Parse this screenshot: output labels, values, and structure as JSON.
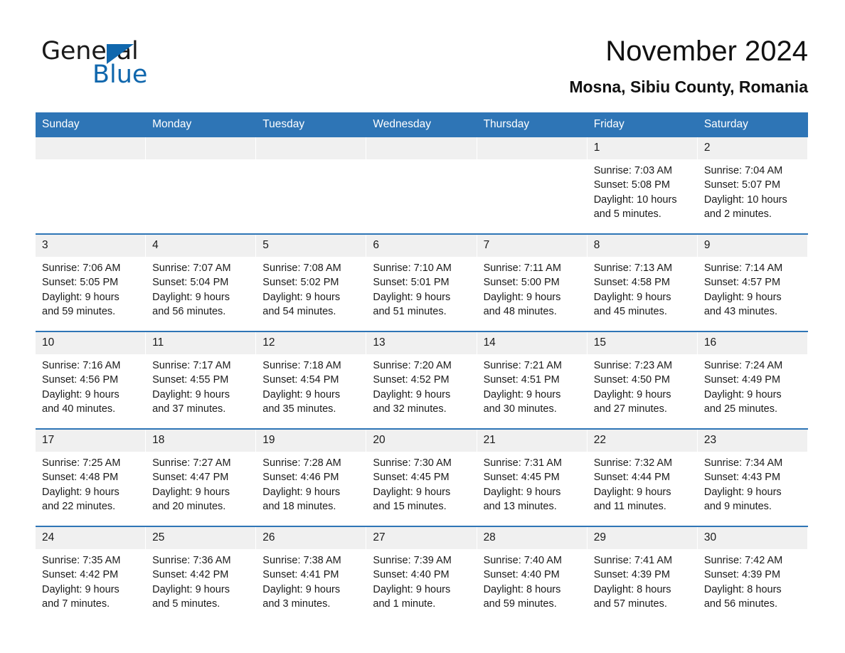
{
  "brand": {
    "name_part1": "General",
    "name_part2": "Blue",
    "accent_color": "#1067ad",
    "triangle_icon": "brand-triangle-icon"
  },
  "header": {
    "title": "November 2024",
    "subtitle": "Mosna, Sibiu County, Romania"
  },
  "theme": {
    "header_blue": "#2e75b6",
    "daynum_band": "#f0f0f0",
    "text": "#1a1a1a"
  },
  "weekday_headers": [
    "Sunday",
    "Monday",
    "Tuesday",
    "Wednesday",
    "Thursday",
    "Friday",
    "Saturday"
  ],
  "weeks": [
    [
      {
        "day": "",
        "sunrise": "",
        "sunset": "",
        "daylight_line1": "",
        "daylight_line2": "",
        "empty": true
      },
      {
        "day": "",
        "sunrise": "",
        "sunset": "",
        "daylight_line1": "",
        "daylight_line2": "",
        "empty": true
      },
      {
        "day": "",
        "sunrise": "",
        "sunset": "",
        "daylight_line1": "",
        "daylight_line2": "",
        "empty": true
      },
      {
        "day": "",
        "sunrise": "",
        "sunset": "",
        "daylight_line1": "",
        "daylight_line2": "",
        "empty": true
      },
      {
        "day": "",
        "sunrise": "",
        "sunset": "",
        "daylight_line1": "",
        "daylight_line2": "",
        "empty": true
      },
      {
        "day": "1",
        "sunrise": "Sunrise: 7:03 AM",
        "sunset": "Sunset: 5:08 PM",
        "daylight_line1": "Daylight: 10 hours",
        "daylight_line2": "and 5 minutes."
      },
      {
        "day": "2",
        "sunrise": "Sunrise: 7:04 AM",
        "sunset": "Sunset: 5:07 PM",
        "daylight_line1": "Daylight: 10 hours",
        "daylight_line2": "and 2 minutes."
      }
    ],
    [
      {
        "day": "3",
        "sunrise": "Sunrise: 7:06 AM",
        "sunset": "Sunset: 5:05 PM",
        "daylight_line1": "Daylight: 9 hours",
        "daylight_line2": "and 59 minutes."
      },
      {
        "day": "4",
        "sunrise": "Sunrise: 7:07 AM",
        "sunset": "Sunset: 5:04 PM",
        "daylight_line1": "Daylight: 9 hours",
        "daylight_line2": "and 56 minutes."
      },
      {
        "day": "5",
        "sunrise": "Sunrise: 7:08 AM",
        "sunset": "Sunset: 5:02 PM",
        "daylight_line1": "Daylight: 9 hours",
        "daylight_line2": "and 54 minutes."
      },
      {
        "day": "6",
        "sunrise": "Sunrise: 7:10 AM",
        "sunset": "Sunset: 5:01 PM",
        "daylight_line1": "Daylight: 9 hours",
        "daylight_line2": "and 51 minutes."
      },
      {
        "day": "7",
        "sunrise": "Sunrise: 7:11 AM",
        "sunset": "Sunset: 5:00 PM",
        "daylight_line1": "Daylight: 9 hours",
        "daylight_line2": "and 48 minutes."
      },
      {
        "day": "8",
        "sunrise": "Sunrise: 7:13 AM",
        "sunset": "Sunset: 4:58 PM",
        "daylight_line1": "Daylight: 9 hours",
        "daylight_line2": "and 45 minutes."
      },
      {
        "day": "9",
        "sunrise": "Sunrise: 7:14 AM",
        "sunset": "Sunset: 4:57 PM",
        "daylight_line1": "Daylight: 9 hours",
        "daylight_line2": "and 43 minutes."
      }
    ],
    [
      {
        "day": "10",
        "sunrise": "Sunrise: 7:16 AM",
        "sunset": "Sunset: 4:56 PM",
        "daylight_line1": "Daylight: 9 hours",
        "daylight_line2": "and 40 minutes."
      },
      {
        "day": "11",
        "sunrise": "Sunrise: 7:17 AM",
        "sunset": "Sunset: 4:55 PM",
        "daylight_line1": "Daylight: 9 hours",
        "daylight_line2": "and 37 minutes."
      },
      {
        "day": "12",
        "sunrise": "Sunrise: 7:18 AM",
        "sunset": "Sunset: 4:54 PM",
        "daylight_line1": "Daylight: 9 hours",
        "daylight_line2": "and 35 minutes."
      },
      {
        "day": "13",
        "sunrise": "Sunrise: 7:20 AM",
        "sunset": "Sunset: 4:52 PM",
        "daylight_line1": "Daylight: 9 hours",
        "daylight_line2": "and 32 minutes."
      },
      {
        "day": "14",
        "sunrise": "Sunrise: 7:21 AM",
        "sunset": "Sunset: 4:51 PM",
        "daylight_line1": "Daylight: 9 hours",
        "daylight_line2": "and 30 minutes."
      },
      {
        "day": "15",
        "sunrise": "Sunrise: 7:23 AM",
        "sunset": "Sunset: 4:50 PM",
        "daylight_line1": "Daylight: 9 hours",
        "daylight_line2": "and 27 minutes."
      },
      {
        "day": "16",
        "sunrise": "Sunrise: 7:24 AM",
        "sunset": "Sunset: 4:49 PM",
        "daylight_line1": "Daylight: 9 hours",
        "daylight_line2": "and 25 minutes."
      }
    ],
    [
      {
        "day": "17",
        "sunrise": "Sunrise: 7:25 AM",
        "sunset": "Sunset: 4:48 PM",
        "daylight_line1": "Daylight: 9 hours",
        "daylight_line2": "and 22 minutes."
      },
      {
        "day": "18",
        "sunrise": "Sunrise: 7:27 AM",
        "sunset": "Sunset: 4:47 PM",
        "daylight_line1": "Daylight: 9 hours",
        "daylight_line2": "and 20 minutes."
      },
      {
        "day": "19",
        "sunrise": "Sunrise: 7:28 AM",
        "sunset": "Sunset: 4:46 PM",
        "daylight_line1": "Daylight: 9 hours",
        "daylight_line2": "and 18 minutes."
      },
      {
        "day": "20",
        "sunrise": "Sunrise: 7:30 AM",
        "sunset": "Sunset: 4:45 PM",
        "daylight_line1": "Daylight: 9 hours",
        "daylight_line2": "and 15 minutes."
      },
      {
        "day": "21",
        "sunrise": "Sunrise: 7:31 AM",
        "sunset": "Sunset: 4:45 PM",
        "daylight_line1": "Daylight: 9 hours",
        "daylight_line2": "and 13 minutes."
      },
      {
        "day": "22",
        "sunrise": "Sunrise: 7:32 AM",
        "sunset": "Sunset: 4:44 PM",
        "daylight_line1": "Daylight: 9 hours",
        "daylight_line2": "and 11 minutes."
      },
      {
        "day": "23",
        "sunrise": "Sunrise: 7:34 AM",
        "sunset": "Sunset: 4:43 PM",
        "daylight_line1": "Daylight: 9 hours",
        "daylight_line2": "and 9 minutes."
      }
    ],
    [
      {
        "day": "24",
        "sunrise": "Sunrise: 7:35 AM",
        "sunset": "Sunset: 4:42 PM",
        "daylight_line1": "Daylight: 9 hours",
        "daylight_line2": "and 7 minutes."
      },
      {
        "day": "25",
        "sunrise": "Sunrise: 7:36 AM",
        "sunset": "Sunset: 4:42 PM",
        "daylight_line1": "Daylight: 9 hours",
        "daylight_line2": "and 5 minutes."
      },
      {
        "day": "26",
        "sunrise": "Sunrise: 7:38 AM",
        "sunset": "Sunset: 4:41 PM",
        "daylight_line1": "Daylight: 9 hours",
        "daylight_line2": "and 3 minutes."
      },
      {
        "day": "27",
        "sunrise": "Sunrise: 7:39 AM",
        "sunset": "Sunset: 4:40 PM",
        "daylight_line1": "Daylight: 9 hours",
        "daylight_line2": "and 1 minute."
      },
      {
        "day": "28",
        "sunrise": "Sunrise: 7:40 AM",
        "sunset": "Sunset: 4:40 PM",
        "daylight_line1": "Daylight: 8 hours",
        "daylight_line2": "and 59 minutes."
      },
      {
        "day": "29",
        "sunrise": "Sunrise: 7:41 AM",
        "sunset": "Sunset: 4:39 PM",
        "daylight_line1": "Daylight: 8 hours",
        "daylight_line2": "and 57 minutes."
      },
      {
        "day": "30",
        "sunrise": "Sunrise: 7:42 AM",
        "sunset": "Sunset: 4:39 PM",
        "daylight_line1": "Daylight: 8 hours",
        "daylight_line2": "and 56 minutes."
      }
    ]
  ]
}
